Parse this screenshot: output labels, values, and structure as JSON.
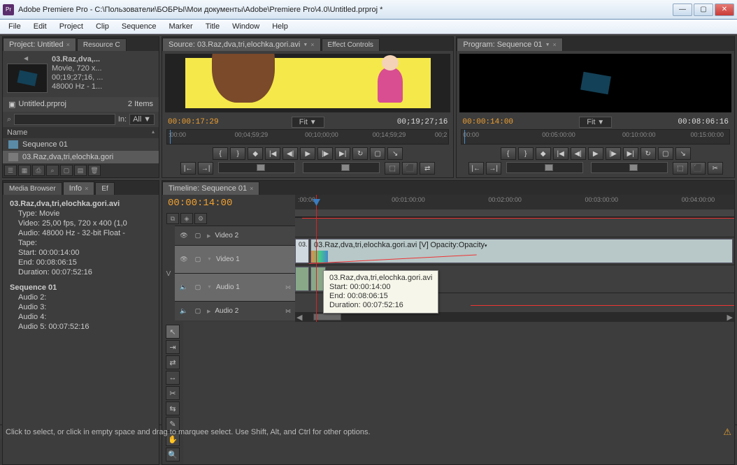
{
  "window": {
    "app_label": "Pr",
    "title": "Adobe Premiere Pro - C:\\Пользователи\\БОБРЫ\\Мои документы\\Adobe\\Premiere Pro\\4.0\\Untitled.prproj *"
  },
  "menu": [
    "File",
    "Edit",
    "Project",
    "Clip",
    "Sequence",
    "Marker",
    "Title",
    "Window",
    "Help"
  ],
  "project_panel": {
    "tabs": [
      "Project: Untitled",
      "Resource C"
    ],
    "clip_name": "03.Raz,dva,...",
    "clip_type": "Movie, 720 x...",
    "clip_tc": "00;19;27;16, ...",
    "clip_audio": "48000 Hz - 1...",
    "bin_name": "Untitled.prproj",
    "item_count": "2 Items",
    "search_label": "In:",
    "filter_all": "All",
    "col_name": "Name",
    "items": [
      {
        "icon": "sequence",
        "label": "Sequence 01"
      },
      {
        "icon": "movie",
        "label": "03.Raz,dva,tri,elochka.gori"
      }
    ]
  },
  "source_monitor": {
    "tab": "Source: 03.Raz,dva,tri,elochka.gori.avi",
    "other_tabs": [
      "Effect Controls"
    ],
    "tc_left": "00:00:17:29",
    "fit": "Fit",
    "tc_right": "00;19;27;16",
    "ruler": [
      ":00:00",
      "00;04;59;29",
      "00;10;00;00",
      "00;14;59;29",
      "00;2"
    ]
  },
  "program_monitor": {
    "tab": "Program: Sequence 01",
    "tc_left": "00:00:14:00",
    "fit": "Fit",
    "tc_right": "00:08:06:16",
    "ruler": [
      "00:00",
      "00:05:00:00",
      "00:10:00:00",
      "00:15:00:00"
    ]
  },
  "info_panel": {
    "tabs": [
      "Media Browser",
      "Info",
      "Ef"
    ],
    "title": "03.Raz,dva,tri,elochka.gori.avi",
    "type_label": "Type:",
    "type": "Movie",
    "video_label": "Video:",
    "video": "25,00 fps, 720 x 400 (1,0",
    "audio_label": "Audio:",
    "audio": "48000 Hz - 32-bit Float -",
    "tape_label": "Tape:",
    "start_label": "Start:",
    "start": "00:00:14:00",
    "end_label": "End:",
    "end": "00:08:06:15",
    "duration_label": "Duration:",
    "duration": "00:07:52:16",
    "seq_title": "Sequence 01",
    "seq_lines": [
      "Audio 2:",
      "Audio 3:",
      "Audio 4:",
      "Audio 5: 00:07:52:16"
    ]
  },
  "timeline": {
    "tab": "Timeline: Sequence 01",
    "tc": "00:00:14:00",
    "ruler": [
      ":00:00",
      "00:01:00:00",
      "00:02:00:00",
      "00:03:00:00",
      "00:04:00:00"
    ],
    "tracks_v": [
      "Video 2",
      "Video 1"
    ],
    "tracks_a": [
      "Audio 1",
      "Audio 2"
    ],
    "v_label": "V",
    "clip_label": "03.Raz,dva,tri,elochka.gori.avi [V]",
    "clip_fx": "Opacity:Opacity",
    "clip_prefix": "03.",
    "tooltip": {
      "name": "03.Raz,dva,tri,elochka.gori.avi",
      "start": "Start: 00:00:14:00",
      "end": "End: 00:08:06:15",
      "dur": "Duration: 00:07:52:16"
    }
  },
  "statusbar": "Click to select, or click in empty space and drag to marquee select. Use Shift, Alt, and Ctrl for other options."
}
